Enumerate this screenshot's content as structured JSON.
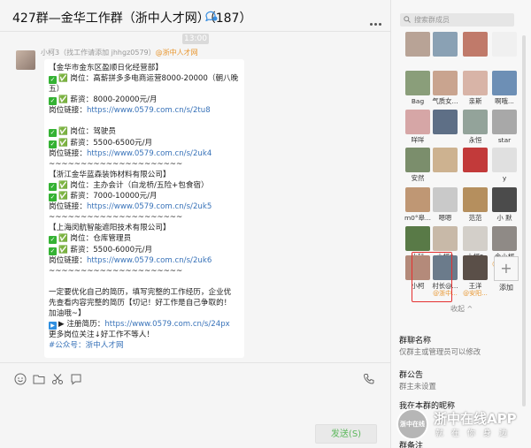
{
  "header": {
    "title": "427群—金华工作群（浙中人才网）（187）"
  },
  "chat": {
    "timestamp": "13:00",
    "sender": {
      "name": "小柯3（找工作请添加 jhhgz0579）",
      "tag": "@浙中人才网"
    },
    "message_lines": [
      "【金华市金东区盈顺日化经营部】",
      "✅ 岗位：高薪拼多多电商运营8000-20000（朝八晚",
      "五）",
      "✅ 薪资：8000-20000元/月",
      "岗位链接：https://www.0579.com.cn/s/2tu8",
      "",
      "✅ 岗位：驾驶员",
      "✅ 薪资：5500-6500元/月",
      "岗位链接：https://www.0579.com.cn/s/2uk4",
      "~~~~~~~~~~~~~~~~~~~~~",
      "【浙江金华蓝森装饰材料有限公司】",
      "✅ 岗位：主办会计（白龙桥/五险+包食宿）",
      "✅ 薪资：7000-10000元/月",
      "岗位链接：https://www.0579.com.cn/s/2uk5",
      "~~~~~~~~~~~~~~~~~~~~~",
      "【上海闵航智能遮阳技术有限公司】",
      "✅ 岗位：仓库管理员",
      "✅ 薪资：5500-6000元/月",
      "岗位链接：https://www.0579.com.cn/s/2uk6",
      "~~~~~~~~~~~~~~~~~~~~~",
      "",
      "一定要优化自己的简历，填写完整的工作经历，企业优",
      "先查看内容完整的简历【切记！好工作是自己争取的！",
      "加油哦~】",
      "▶ 注册简历：https://www.0579.com.cn/s/24px",
      "更多岗位关注↓好工作不等人！",
      "#公众号：浙中人才网"
    ],
    "send_label": "发送(S)"
  },
  "sidebar": {
    "search_placeholder": "搜索群成员",
    "members": [
      {
        "name": "",
        "sub": "",
        "color": "#b8a396"
      },
      {
        "name": "",
        "sub": "",
        "color": "#8aa1b4"
      },
      {
        "name": "",
        "sub": "",
        "color": "#c07a6a"
      },
      {
        "name": "",
        "sub": "",
        "color": "#f0f0f0"
      },
      {
        "name": "Bag",
        "sub": "",
        "color": "#8a9e7a"
      },
      {
        "name": "气质女...",
        "sub": "",
        "color": "#c9a48f"
      },
      {
        "name": "亲斯",
        "sub": "",
        "color": "#d8b4a7"
      },
      {
        "name": "啊哦...",
        "sub": "",
        "color": "#6d8fb5"
      },
      {
        "name": "咩咩",
        "sub": "",
        "color": "#d6a6a6"
      },
      {
        "name": "",
        "sub": "",
        "color": "#5e6f86"
      },
      {
        "name": "永恒",
        "sub": "",
        "color": "#93a39a"
      },
      {
        "name": "star",
        "sub": "",
        "color": "#a8a8a8"
      },
      {
        "name": "安然",
        "sub": "",
        "color": "#7b8e6c"
      },
      {
        "name": "",
        "sub": "",
        "color": "#cdb290"
      },
      {
        "name": "",
        "sub": "",
        "color": "#c23a3a"
      },
      {
        "name": "y",
        "sub": "",
        "color": "#e0e0e0"
      },
      {
        "name": "m0°皋...",
        "sub": "",
        "color": "#bf9774"
      },
      {
        "name": "嗯嗯",
        "sub": "",
        "color": "#c9c9c9"
      },
      {
        "name": "范范",
        "sub": "",
        "color": "#b58f5e"
      },
      {
        "name": "小 默",
        "sub": "",
        "color": "#4b4b4b"
      },
      {
        "name": "小科",
        "sub": "",
        "color": "#597a47"
      },
      {
        "name": "小柯3",
        "sub": "@浙中...",
        "color": "#c8b9a8"
      },
      {
        "name": "小柯5",
        "sub": "@浙中...",
        "color": "#d3cfc9"
      },
      {
        "name": "金小柯",
        "sub": "@浙中...",
        "color": "#8f8a86"
      },
      {
        "name": "小柯",
        "sub": "",
        "color": "#b48a7a"
      },
      {
        "name": "村长@...",
        "sub": "@浙中...",
        "color": "#6b7b8b"
      },
      {
        "name": "王洋",
        "sub": "@安阳...",
        "color": "#5a4f48"
      }
    ],
    "add_label": "添加",
    "collapse_label": "收起 ^",
    "group_name_title": "群聊名称",
    "group_name_value": "仅群主或管理员可以修改",
    "announcement_title": "群公告",
    "announcement_value": "群主未设置",
    "nickname_title": "我在本群的昵称",
    "remark_title": "群备注",
    "watermark_title": "浙中在线APP",
    "watermark_sub": "就在你身边",
    "watermark_logo": "浙中在线"
  }
}
